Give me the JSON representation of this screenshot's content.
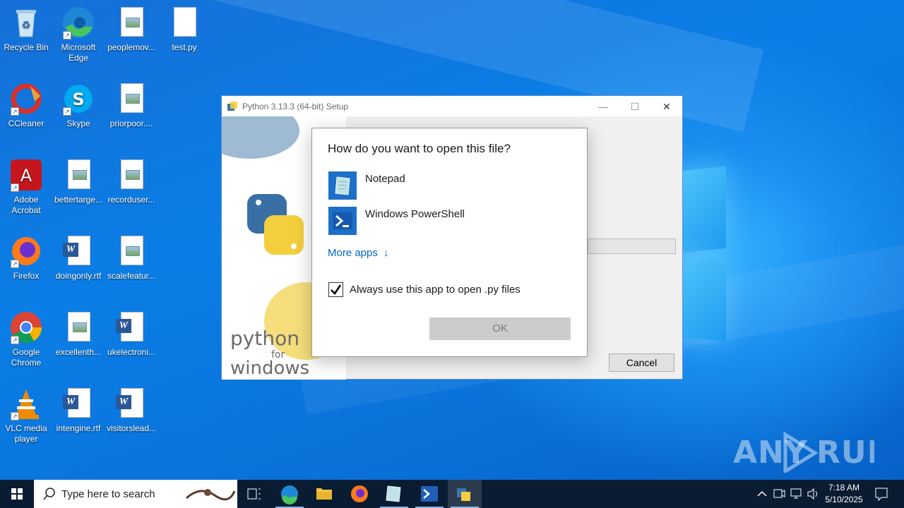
{
  "desktop": {
    "icons": [
      {
        "label": "Recycle Bin"
      },
      {
        "label": "Microsoft Edge"
      },
      {
        "label": "peoplemov..."
      },
      {
        "label": "test.py"
      },
      {
        "label": "CCleaner"
      },
      {
        "label": "Skype"
      },
      {
        "label": "priorpoor...."
      },
      {
        "label": "Adobe Acrobat"
      },
      {
        "label": "bettertarge..."
      },
      {
        "label": "recorduser..."
      },
      {
        "label": "Firefox"
      },
      {
        "label": "doingonly.rtf"
      },
      {
        "label": "scalefeatur..."
      },
      {
        "label": "Google Chrome"
      },
      {
        "label": "excellenth..."
      },
      {
        "label": "ukelectroni..."
      },
      {
        "label": "VLC media player"
      },
      {
        "label": "intengine.rtf"
      },
      {
        "label": "visitorslead..."
      }
    ]
  },
  "setup_window": {
    "title": "Python 3.13.3 (64-bit) Setup",
    "side_text_1": "python",
    "side_text_2": "for",
    "side_text_3": "windows",
    "cancel_label": "Cancel"
  },
  "open_with": {
    "question": "How do you want to open this file?",
    "apps": [
      {
        "label": "Notepad",
        "icon": "notepad-icon"
      },
      {
        "label": "Windows PowerShell",
        "icon": "powershell-icon"
      }
    ],
    "more_apps": "More apps",
    "more_apps_arrow": "↓",
    "always_use": "Always use this app to open .py files",
    "always_use_checked": true,
    "ok_label": "OK"
  },
  "watermark": {
    "text": "ANY RUN"
  },
  "taskbar": {
    "search_placeholder": "Type here to search",
    "time": "7:18 AM",
    "date": "5/10/2025"
  },
  "colors": {
    "accent": "#0067c0",
    "taskbar": "#0a1c32",
    "desktop": "#0a73da"
  }
}
